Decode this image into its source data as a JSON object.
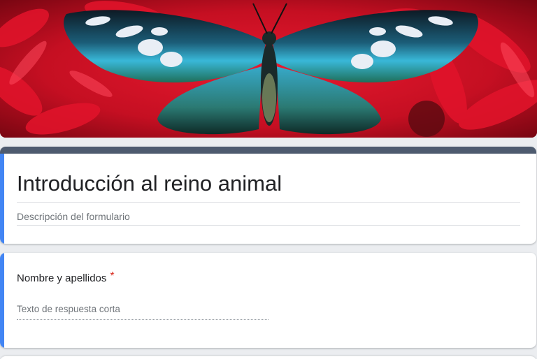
{
  "header": {
    "banner_image": "butterfly-on-red-flowers"
  },
  "form": {
    "title": "Introducción al reino animal",
    "description_placeholder": "Descripción del formulario",
    "accent_color": "#4285f4",
    "header_bar_color": "#4e5b6f"
  },
  "questions": [
    {
      "title": "Nombre y apellidos",
      "required_marker": "*",
      "answer_placeholder": "Texto de respuesta corta"
    }
  ]
}
